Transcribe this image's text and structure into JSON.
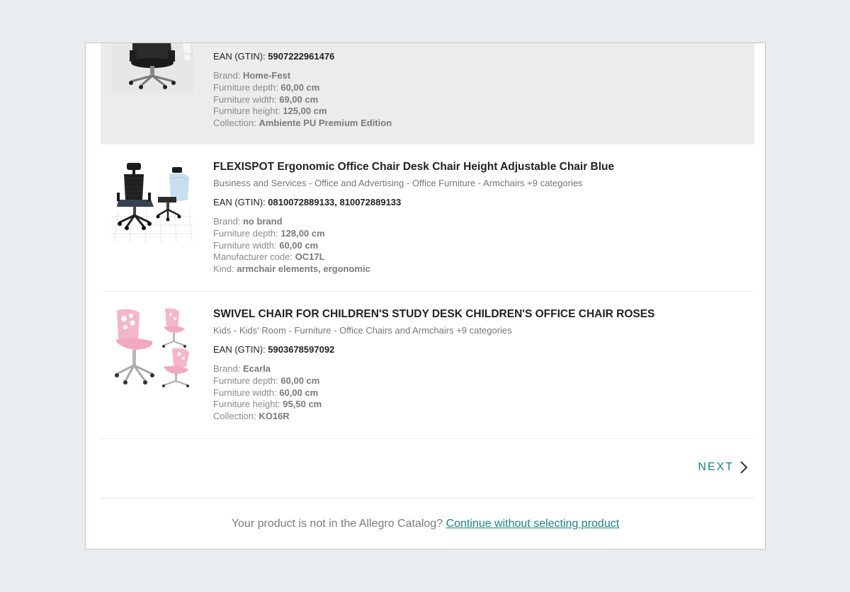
{
  "products": [
    {
      "title": "",
      "categories": "",
      "ean_label": "EAN (GTIN):",
      "ean_value": "5907222961476",
      "attributes": [
        {
          "label": "Brand:",
          "value": "Home-Fest"
        },
        {
          "label": "Furniture depth:",
          "value": "60,00 cm"
        },
        {
          "label": "Furniture width:",
          "value": "69,00 cm"
        },
        {
          "label": "Furniture height:",
          "value": "125,00 cm"
        },
        {
          "label": "Collection:",
          "value": "Ambiente PU Premium Edition"
        }
      ],
      "image_icon": "black-office-chair-image"
    },
    {
      "title": "FLEXISPOT Ergonomic Office Chair Desk Chair Height Adjustable Chair Blue",
      "categories": "Business and Services - Office and Advertising - Office Furniture - Armchairs +9 categories",
      "ean_label": "EAN (GTIN):",
      "ean_value": "0810072889133, 810072889133",
      "attributes": [
        {
          "label": "Brand:",
          "value": "no brand"
        },
        {
          "label": "Furniture depth:",
          "value": "128,00 cm"
        },
        {
          "label": "Furniture width:",
          "value": "60,00 cm"
        },
        {
          "label": "Manufacturer code:",
          "value": "OC17L"
        },
        {
          "label": "Kind:",
          "value": "armchair elements, ergonomic"
        }
      ],
      "image_icon": "ergonomic-mesh-chair-image"
    },
    {
      "title": "SWIVEL CHAIR FOR CHILDREN'S STUDY DESK CHILDREN'S OFFICE CHAIR ROSES",
      "categories": "Kids - Kids' Room - Furniture - Office Chairs and Armchairs +9 categories",
      "ean_label": "EAN (GTIN):",
      "ean_value": "5903678597092",
      "attributes": [
        {
          "label": "Brand:",
          "value": "Ecarla"
        },
        {
          "label": "Furniture depth:",
          "value": "60,00 cm"
        },
        {
          "label": "Furniture width:",
          "value": "60,00 cm"
        },
        {
          "label": "Furniture height:",
          "value": "95,50 cm"
        },
        {
          "label": "Collection:",
          "value": "KO16R"
        }
      ],
      "image_icon": "pink-swivel-chair-image"
    }
  ],
  "pagination": {
    "next_label": "NEXT",
    "next_icon": "chevron-right-icon"
  },
  "footer": {
    "text": "Your product is not in the Allegro Catalog?",
    "link": "Continue without selecting product"
  },
  "colors": {
    "accent": "#1d8181",
    "selected_row_bg": "#ececec",
    "page_bg": "#e9edf0"
  }
}
